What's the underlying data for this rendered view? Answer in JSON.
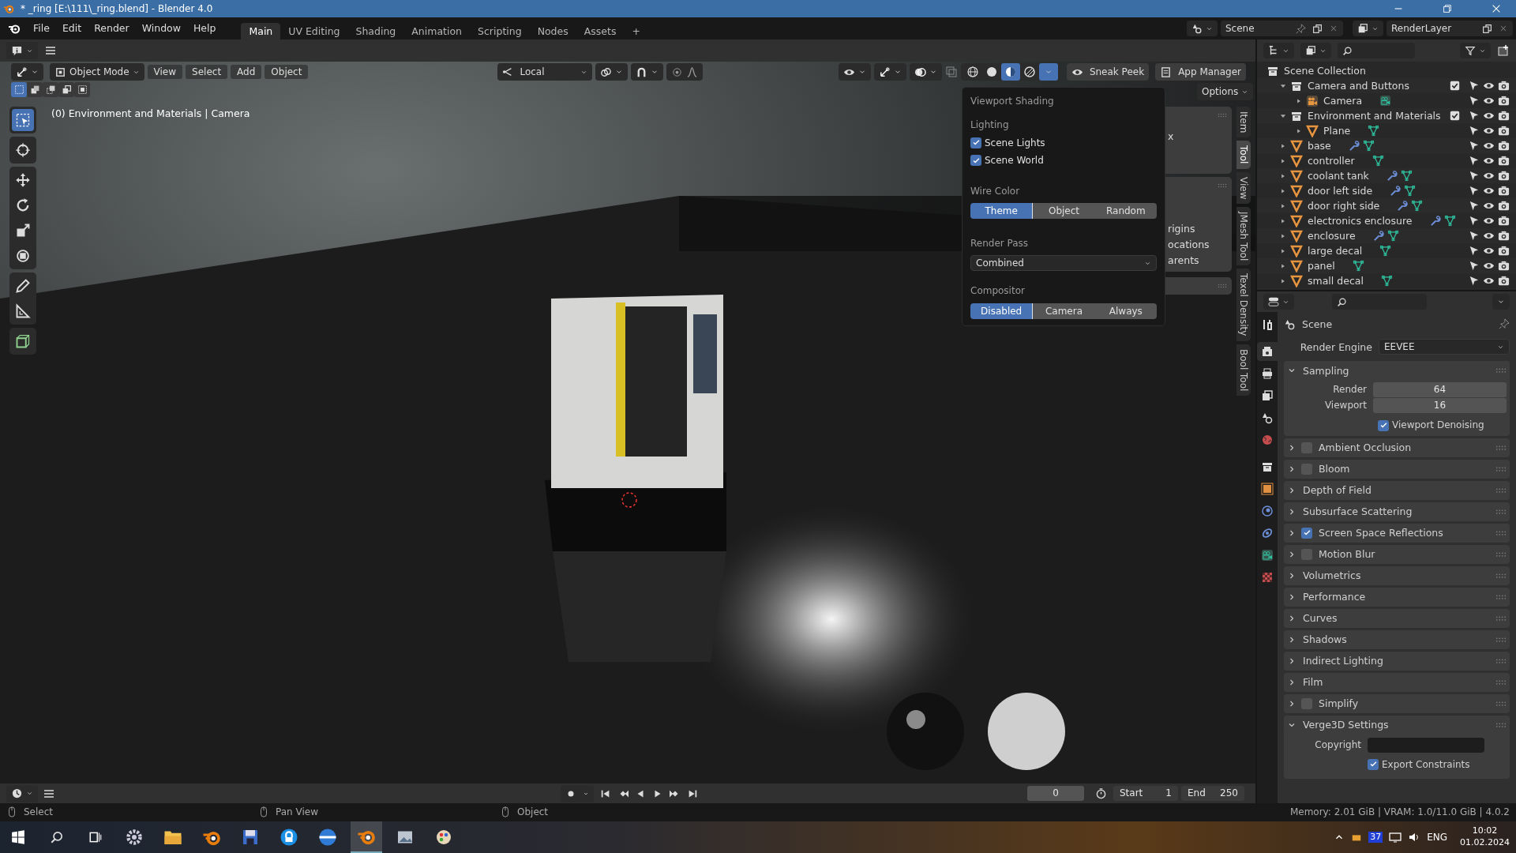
{
  "window": {
    "title": "* _ring [E:\\111\\_ring.blend] - Blender 4.0"
  },
  "menu": [
    "File",
    "Edit",
    "Render",
    "Window",
    "Help"
  ],
  "workspaces": [
    {
      "label": "Main",
      "selected": true
    },
    {
      "label": "UV Editing",
      "selected": false
    },
    {
      "label": "Shading",
      "selected": false
    },
    {
      "label": "Animation",
      "selected": false
    },
    {
      "label": "Scripting",
      "selected": false
    },
    {
      "label": "Nodes",
      "selected": false
    },
    {
      "label": "Assets",
      "selected": false
    }
  ],
  "add_workspace": "+",
  "scene_selector": {
    "scene": "Scene",
    "view_layer": "RenderLayer"
  },
  "viewport": {
    "mode": "Object Mode",
    "menus": [
      "View",
      "Select",
      "Add",
      "Object"
    ],
    "orientation": "Local",
    "shading_modes": [
      {
        "kind": "wireframe",
        "selected": false
      },
      {
        "kind": "solid",
        "selected": false
      },
      {
        "kind": "material",
        "selected": true
      },
      {
        "kind": "rendered",
        "selected": false
      }
    ],
    "buttons": [
      {
        "kind": "eye",
        "label": "Sneak Peek"
      },
      {
        "kind": "doc",
        "label": "App Manager"
      }
    ],
    "options": "Options",
    "overlay_text": "(0) Environment and Materials | Camera",
    "tools": [
      {
        "kind": "select",
        "selected": true
      },
      {
        "kind": "cursor",
        "selected": false
      },
      {
        "kind": "move",
        "selected": false
      },
      {
        "kind": "rotate",
        "selected": false
      },
      {
        "kind": "scale",
        "selected": false
      },
      {
        "kind": "transform",
        "selected": false
      },
      {
        "kind": "annotate",
        "selected": false
      },
      {
        "kind": "measure",
        "selected": false
      },
      {
        "kind": "add-cube",
        "selected": false
      }
    ],
    "select_modes": [
      {
        "kind": "set",
        "selected": true
      },
      {
        "kind": "extend",
        "selected": false
      },
      {
        "kind": "subtract",
        "selected": false
      },
      {
        "kind": "invert",
        "selected": false
      },
      {
        "kind": "intersect",
        "selected": false
      }
    ],
    "sidebar_tabs": [
      {
        "label": "Item",
        "selected": false
      },
      {
        "label": "Tool",
        "selected": true
      },
      {
        "label": "View",
        "selected": false
      },
      {
        "label": "JMesh Tool",
        "selected": false
      },
      {
        "label": "Texel Density",
        "selected": false
      },
      {
        "label": "Bool Tool",
        "selected": false
      }
    ],
    "sidebar_panels": [
      {
        "texts": [
          "x"
        ]
      },
      {
        "texts": [
          "rigins",
          "ocations",
          "arents"
        ]
      }
    ]
  },
  "shading_popover": {
    "title": "Viewport Shading",
    "lighting_label": "Lighting",
    "lighting": [
      {
        "label": "Scene Lights",
        "checked": true
      },
      {
        "label": "Scene World",
        "checked": true
      }
    ],
    "wire_color_label": "Wire Color",
    "wire_color": [
      {
        "label": "Theme",
        "selected": true
      },
      {
        "label": "Object",
        "selected": false
      },
      {
        "label": "Random",
        "selected": false
      }
    ],
    "render_pass_label": "Render Pass",
    "render_pass": "Combined",
    "compositor_label": "Compositor",
    "compositor": [
      {
        "label": "Disabled",
        "selected": true
      },
      {
        "label": "Camera",
        "selected": false
      },
      {
        "label": "Always",
        "selected": false
      }
    ]
  },
  "outliner": {
    "root": "Scene Collection",
    "items": [
      {
        "label": "Camera and Buttons",
        "kind": "collection",
        "expanded": true,
        "checked": true,
        "children": [
          {
            "label": "Camera",
            "kind": "camera",
            "expanded": false,
            "modifier": false
          }
        ]
      },
      {
        "label": "Environment and Materials",
        "kind": "collection",
        "expanded": true,
        "checked": true,
        "children": [
          {
            "label": "Plane",
            "kind": "mesh",
            "expanded": false,
            "modifier": false
          }
        ]
      },
      {
        "label": "base",
        "kind": "mesh",
        "expanded": false,
        "modifier": true
      },
      {
        "label": "controller",
        "kind": "mesh",
        "expanded": false,
        "modifier": false
      },
      {
        "label": "coolant tank",
        "kind": "mesh",
        "expanded": false,
        "modifier": true
      },
      {
        "label": "door left side",
        "kind": "mesh",
        "expanded": false,
        "modifier": true
      },
      {
        "label": "door right side",
        "kind": "mesh",
        "expanded": false,
        "modifier": true
      },
      {
        "label": "electronics enclosure",
        "kind": "mesh",
        "expanded": false,
        "modifier": true
      },
      {
        "label": "enclosure",
        "kind": "mesh",
        "expanded": false,
        "modifier": true
      },
      {
        "label": "large decal",
        "kind": "mesh",
        "expanded": false,
        "modifier": false
      },
      {
        "label": "panel",
        "kind": "mesh",
        "expanded": false,
        "modifier": false
      },
      {
        "label": "small decal",
        "kind": "mesh",
        "expanded": false,
        "modifier": false
      }
    ]
  },
  "properties": {
    "tabs": [
      {
        "kind": "tool",
        "selected": false
      },
      {
        "kind": "render",
        "selected": true
      },
      {
        "kind": "output",
        "selected": false
      },
      {
        "kind": "view-layer",
        "selected": false
      },
      {
        "kind": "scene",
        "selected": false
      },
      {
        "kind": "world",
        "selected": false
      },
      {
        "kind": "collection",
        "selected": false
      },
      {
        "kind": "object",
        "selected": false
      },
      {
        "kind": "physics",
        "selected": false
      },
      {
        "kind": "constraints",
        "selected": false
      },
      {
        "kind": "data",
        "selected": false
      },
      {
        "kind": "texture",
        "selected": false
      }
    ],
    "context": "Scene",
    "engine_label": "Render Engine",
    "engine": "EEVEE",
    "sampling": {
      "label": "Sampling",
      "expanded": true,
      "fields": [
        {
          "label": "Render",
          "value": "64"
        },
        {
          "label": "Viewport",
          "value": "16"
        }
      ],
      "denoise": {
        "label": "Viewport Denoising",
        "checked": true
      }
    },
    "panels": [
      {
        "label": "Ambient Occlusion",
        "kind": "toggle",
        "checked": false,
        "expanded": false
      },
      {
        "label": "Bloom",
        "kind": "toggle",
        "checked": false,
        "expanded": false
      },
      {
        "label": "Depth of Field",
        "kind": "plain",
        "expanded": false
      },
      {
        "label": "Subsurface Scattering",
        "kind": "plain",
        "expanded": false
      },
      {
        "label": "Screen Space Reflections",
        "kind": "toggle",
        "checked": true,
        "expanded": false
      },
      {
        "label": "Motion Blur",
        "kind": "toggle",
        "checked": false,
        "expanded": false
      },
      {
        "label": "Volumetrics",
        "kind": "plain",
        "expanded": false
      },
      {
        "label": "Performance",
        "kind": "plain",
        "expanded": false
      },
      {
        "label": "Curves",
        "kind": "plain",
        "expanded": false
      },
      {
        "label": "Shadows",
        "kind": "plain",
        "expanded": false
      },
      {
        "label": "Indirect Lighting",
        "kind": "plain",
        "expanded": false
      },
      {
        "label": "Film",
        "kind": "plain",
        "expanded": false
      },
      {
        "label": "Simplify",
        "kind": "toggle",
        "checked": false,
        "expanded": false
      }
    ],
    "verge3d": {
      "label": "Verge3D Settings",
      "expanded": true,
      "copyright_label": "Copyright",
      "export_constraints": {
        "label": "Export Constraints",
        "checked": true
      }
    }
  },
  "timeline": {
    "frame": "0",
    "start_label": "Start",
    "start": "1",
    "end_label": "End",
    "end": "250"
  },
  "status_bar": {
    "hints": [
      "Select",
      "Pan View",
      "Object"
    ],
    "stats": "Memory: 2.01 GiB | VRAM: 1.0/11.0 GiB | 4.0.2"
  },
  "taskbar": {
    "apps": [
      {
        "kind": "start",
        "selected": false
      },
      {
        "kind": "search",
        "selected": false
      },
      {
        "kind": "task-view",
        "selected": false
      },
      {
        "kind": "gear",
        "selected": false
      },
      {
        "kind": "folder",
        "selected": false
      },
      {
        "kind": "blender",
        "selected": false
      },
      {
        "kind": "floppy",
        "selected": false
      },
      {
        "kind": "lock",
        "selected": false
      },
      {
        "kind": "globe",
        "selected": false
      },
      {
        "kind": "blender",
        "selected": true
      },
      {
        "kind": "photos",
        "selected": false
      },
      {
        "kind": "paint",
        "selected": false
      }
    ],
    "badge": "37",
    "language": "ENG",
    "time": "10:02",
    "date": "01.02.2024"
  }
}
